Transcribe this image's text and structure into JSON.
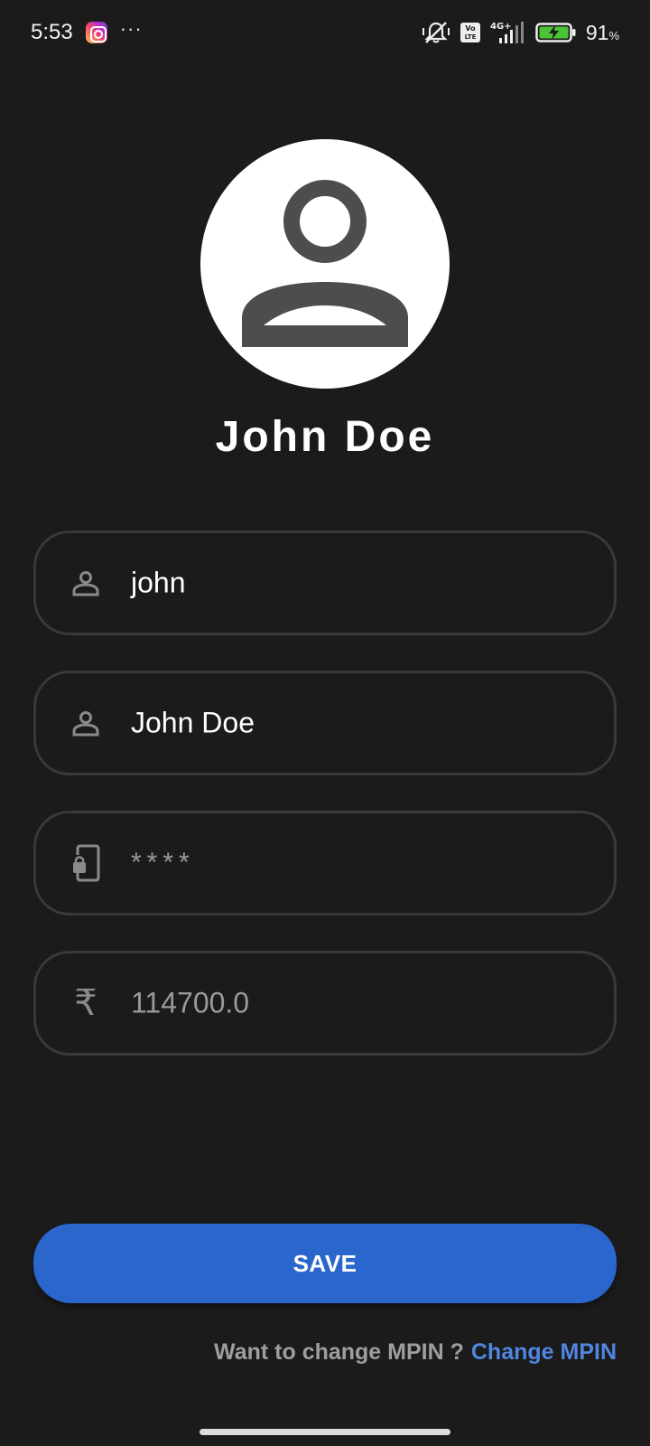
{
  "status_bar": {
    "time": "5:53",
    "more": "···",
    "network": "4G+",
    "volte": "Vo LTE",
    "battery_percent": "91",
    "battery_unit": "%",
    "icons": [
      "instagram-icon",
      "silent-icon",
      "volte-icon",
      "signal-icon",
      "battery-charging-icon"
    ]
  },
  "profile": {
    "display_name": "John Doe",
    "avatar_icon": "person-icon"
  },
  "form": {
    "fields": [
      {
        "icon": "person-icon",
        "value": "john"
      },
      {
        "icon": "person-icon",
        "value": "John Doe"
      },
      {
        "icon": "phone-lock-icon",
        "value": "****"
      },
      {
        "icon": "rupee-icon",
        "symbol": "₹",
        "value": "114700.0"
      }
    ]
  },
  "actions": {
    "save_label": "SAVE",
    "mpin_prompt": "Want to change MPIN ?",
    "mpin_link": "Change MPIN"
  },
  "colors": {
    "background": "#1b1b1b",
    "accent": "#2b66cc",
    "link": "#4f86e0",
    "field_border": "#393939"
  }
}
